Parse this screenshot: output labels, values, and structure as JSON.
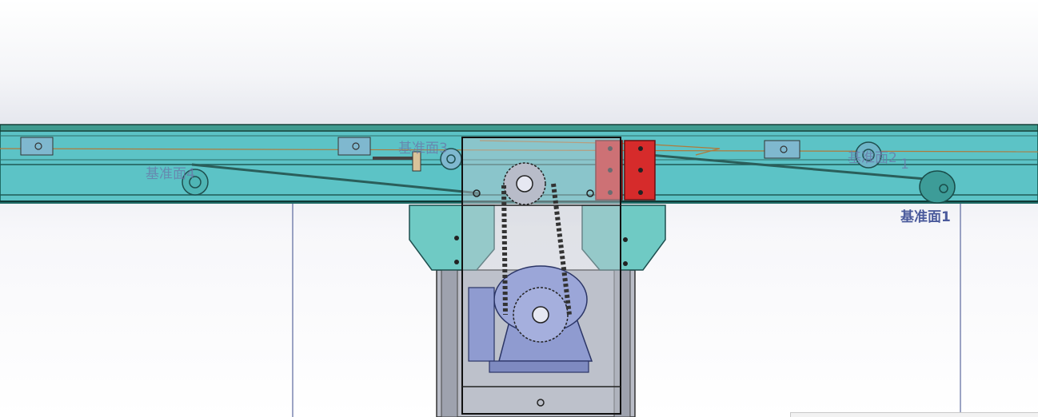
{
  "viewport": {
    "background_top": "#ffffff",
    "background_band": "#e3e5ec",
    "frame_color": "#5cc3c6",
    "frame_dark": "#1f6b66",
    "bracket_color": "#6fcac4",
    "red_plate_color": "#d62b2b",
    "motor_color": "#8f9bd0",
    "housing_color": "#c4c7d0"
  },
  "reference_planes": {
    "plane_1": "基准面1",
    "plane_2": "基准面2",
    "plane_3": "基准面3",
    "plane_4": "基准面4",
    "plane_2_suffix": "1"
  }
}
